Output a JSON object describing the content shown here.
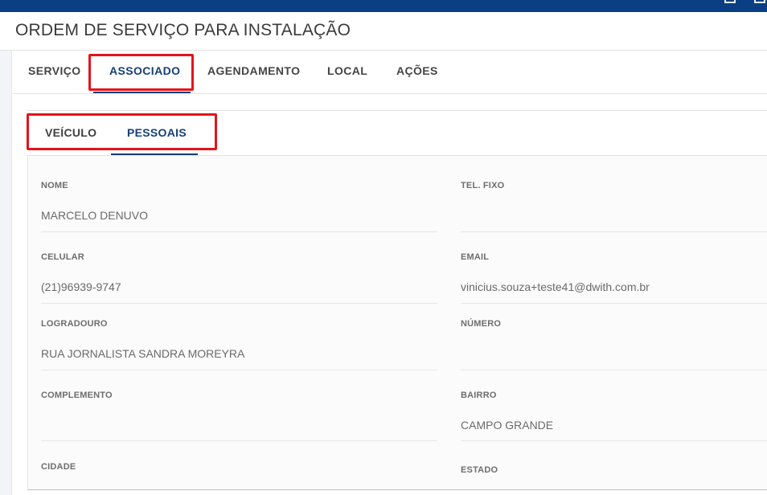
{
  "page": {
    "title": "ORDEM DE SERVIÇO PARA INSTALAÇÃO"
  },
  "main_tabs": [
    {
      "label": "SERVIÇO",
      "active": false
    },
    {
      "label": "ASSOCIADO",
      "active": true
    },
    {
      "label": "AGENDAMENTO",
      "active": false
    },
    {
      "label": "LOCAL",
      "active": false
    },
    {
      "label": "AÇÕES",
      "active": false
    }
  ],
  "sub_tabs": [
    {
      "label": "VEÍCULO",
      "active": false
    },
    {
      "label": "PESSOAIS",
      "active": true
    }
  ],
  "fields": {
    "nome": {
      "label": "NOME",
      "value": "MARCELO DENUVO"
    },
    "tel_fixo": {
      "label": "TEL. FIXO",
      "value": ""
    },
    "celular": {
      "label": "CELULAR",
      "value": "(21)96939-9747"
    },
    "email": {
      "label": "EMAIL",
      "value": "vinicius.souza+teste41@dwith.com.br"
    },
    "logradouro": {
      "label": "LOGRADOURO",
      "value": "RUA JORNALISTA SANDRA MOREYRA"
    },
    "numero": {
      "label": "NÚMERO",
      "value": ""
    },
    "complemento": {
      "label": "COMPLEMENTO",
      "value": ""
    },
    "bairro": {
      "label": "BAIRRO",
      "value": "CAMPO GRANDE"
    },
    "cidade": {
      "label": "CIDADE",
      "value": ""
    },
    "estado": {
      "label": "ESTADO",
      "value": ""
    }
  },
  "colors": {
    "topbar": "#0b3f84",
    "accent": "#153f7a",
    "highlight_box": "#e3141b"
  }
}
